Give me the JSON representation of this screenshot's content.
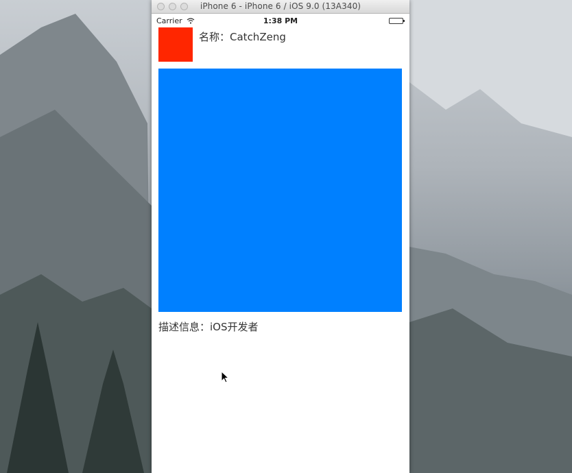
{
  "window": {
    "title": "iPhone 6 - iPhone 6 / iOS 9.0 (13A340)"
  },
  "status_bar": {
    "carrier": "Carrier",
    "time": "1:38 PM",
    "wifi_icon": "wifi-icon",
    "battery_icon": "battery-icon"
  },
  "profile": {
    "name_label": "名称：",
    "name_value": "CatchZeng",
    "avatar_color": "#ff2600"
  },
  "content": {
    "image_color": "#0080ff"
  },
  "description": {
    "label": "描述信息：",
    "value": "iOS开发者"
  },
  "colors": {
    "screen_background": "#ffffff",
    "window_chrome": "#e4e4e4"
  }
}
